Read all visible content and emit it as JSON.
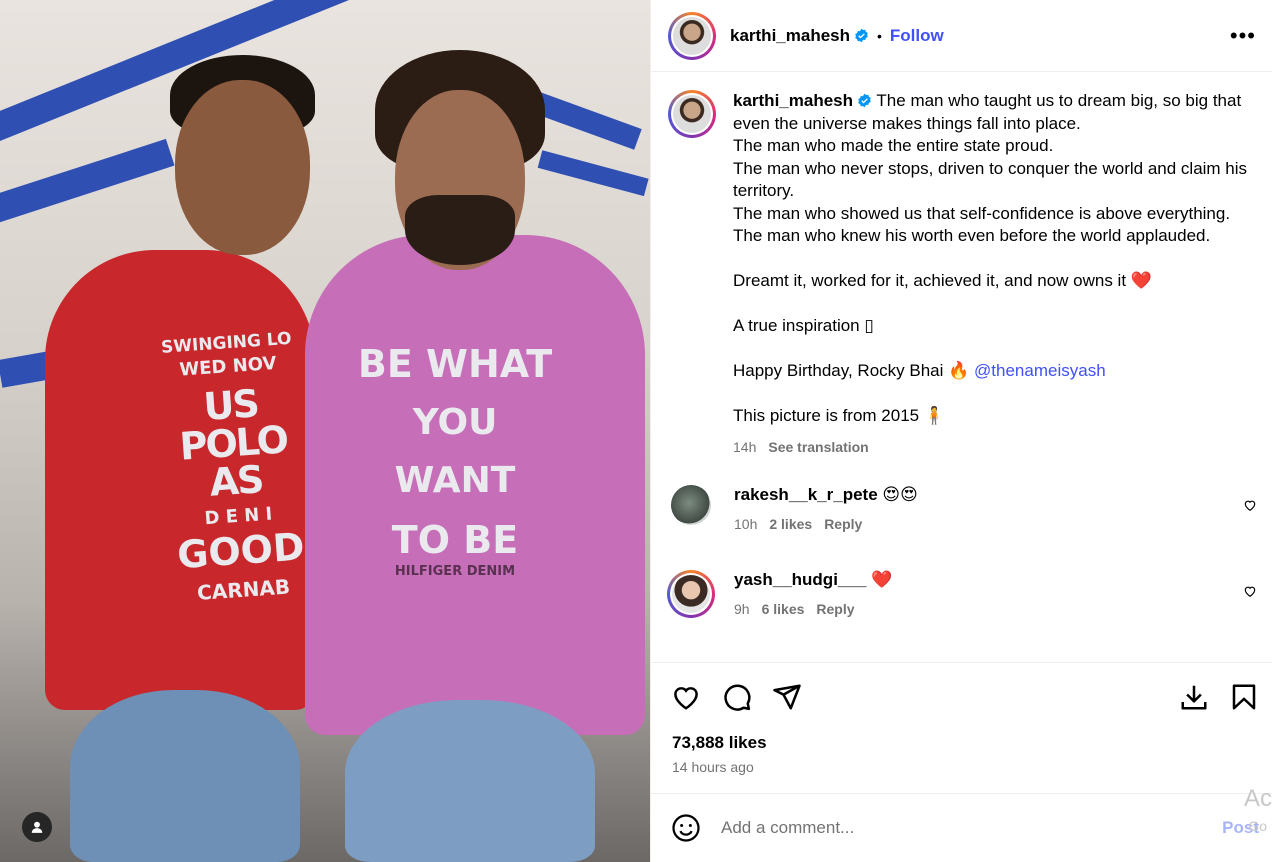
{
  "post": {
    "author": "karthi_mahesh",
    "follow_label": "Follow",
    "separator": "•",
    "more_label": "•••",
    "caption_author": "karthi_mahesh",
    "caption_lines": [
      "The man who taught us to dream big, so big that even the universe makes things fall into place.",
      "The man who made the entire state proud.",
      "The man who never stops, driven to conquer the world and claim his territory.",
      "The man who showed us that self-confidence is above everything.",
      "The man who knew his worth even before the world applauded."
    ],
    "caption_line_2": "Dreamt it, worked for it, achieved it, and now owns it",
    "caption_line_2_emoji": "❤️",
    "caption_line_3": "A true inspiration ▯",
    "caption_line_4": "Happy Birthday, Rocky Bhai",
    "caption_line_4_emoji": "🔥",
    "caption_mention": "@thenameisyash",
    "caption_line_5": "This picture is from 2015",
    "caption_line_5_emoji": "🧍",
    "caption_age": "14h",
    "see_translation": "See translation"
  },
  "photo": {
    "shirt1_lines": [
      "SWINGING LO",
      "WED NOV",
      "US POLO AS",
      "D E N I",
      "GOOD",
      "CARNAB"
    ],
    "shirt2_lines": [
      "BE WHAT",
      "YOU",
      "WANT",
      "TO BE",
      "HILFIGER DENIM"
    ]
  },
  "comments": [
    {
      "user": "rakesh__k_r_pete",
      "text": "😍😍",
      "age": "10h",
      "likes": "2 likes",
      "reply": "Reply"
    },
    {
      "user": "yash__hudgi___",
      "text": "❤️",
      "age": "9h",
      "likes": "6 likes",
      "reply": "Reply"
    }
  ],
  "stats": {
    "likes": "73,888 likes",
    "time_ago": "14 hours ago"
  },
  "composer": {
    "placeholder": "Add a comment...",
    "post_label": "Post"
  },
  "watermark": {
    "main": "Ac",
    "sub": "Go"
  },
  "colors": {
    "link": "#4150f7",
    "muted": "#737373",
    "post_disabled": "#a8b4f8"
  },
  "icons": [
    "verified-icon",
    "more-icon",
    "heart-icon",
    "comment-icon",
    "share-icon",
    "save-icon",
    "bookmark-icon",
    "emoji-icon",
    "user-tag-icon"
  ]
}
